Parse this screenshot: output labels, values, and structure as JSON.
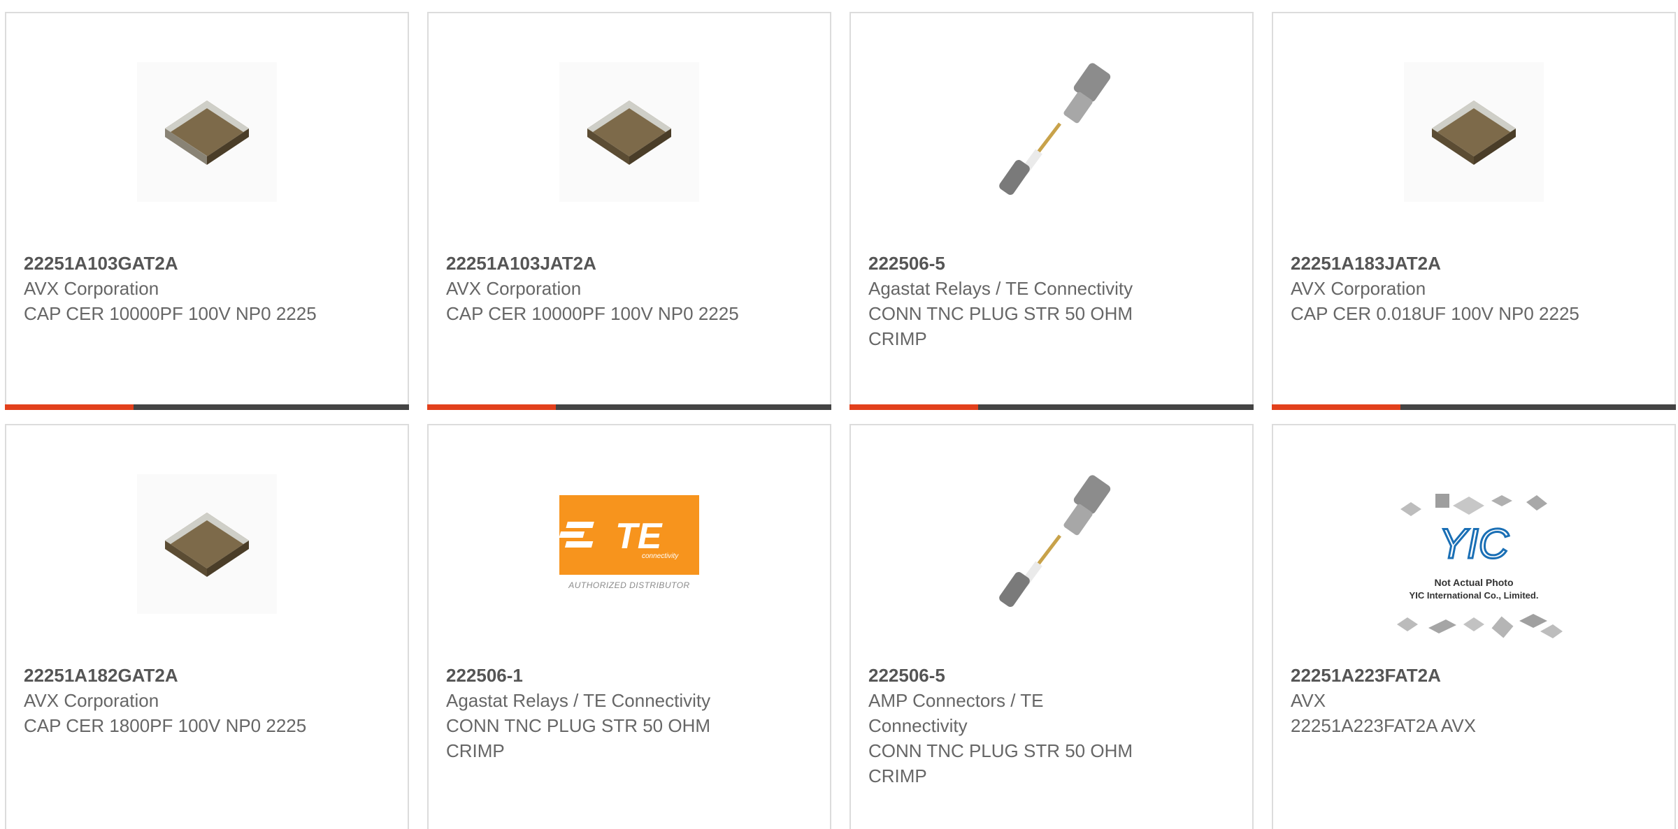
{
  "products": [
    {
      "part_number": "22251A103GAT2A",
      "manufacturer": "AVX Corporation",
      "description": "CAP CER 10000PF 100V NP0 2225",
      "image": "ceramic-capacitor-image"
    },
    {
      "part_number": "22251A103JAT2A",
      "manufacturer": "AVX Corporation",
      "description": "CAP CER 10000PF 100V NP0 2225",
      "image": "ceramic-capacitor-image"
    },
    {
      "part_number": "222506-5",
      "manufacturer": "Agastat Relays / TE Connectivity",
      "description": "CONN TNC PLUG STR 50 OHM CRIMP",
      "image": "tnc-connector-image"
    },
    {
      "part_number": "22251A183JAT2A",
      "manufacturer": "AVX Corporation",
      "description": "CAP CER 0.018UF 100V NP0 2225",
      "image": "ceramic-capacitor-image"
    },
    {
      "part_number": "22251A182GAT2A",
      "manufacturer": "AVX Corporation",
      "description": "CAP CER 1800PF 100V NP0 2225",
      "image": "ceramic-capacitor-image"
    },
    {
      "part_number": "222506-1",
      "manufacturer": "Agastat Relays / TE Connectivity",
      "description": "CONN TNC PLUG STR 50 OHM CRIMP",
      "image": "te-connectivity-logo"
    },
    {
      "part_number": "222506-5",
      "manufacturer": "AMP Connectors / TE Connectivity",
      "description": "CONN TNC PLUG STR 50 OHM CRIMP",
      "image": "tnc-connector-image"
    },
    {
      "part_number": "22251A223FAT2A",
      "manufacturer": "AVX",
      "description": "22251A223FAT2A AVX",
      "image": "not-actual-photo-placeholder"
    }
  ],
  "te_logo": {
    "letters": "TE",
    "subtitle": "connectivity",
    "caption": "AUTHORIZED DISTRIBUTOR"
  },
  "yic_placeholder": {
    "logo_text": "YIC",
    "line1": "Not Actual Photo",
    "line2": "YIC International Co., Limited."
  },
  "colors": {
    "accent": "#e2401c",
    "bar": "#444444",
    "border": "#dcdcdc",
    "te_orange": "#f7941d",
    "yic_blue": "#1a6fb5"
  }
}
